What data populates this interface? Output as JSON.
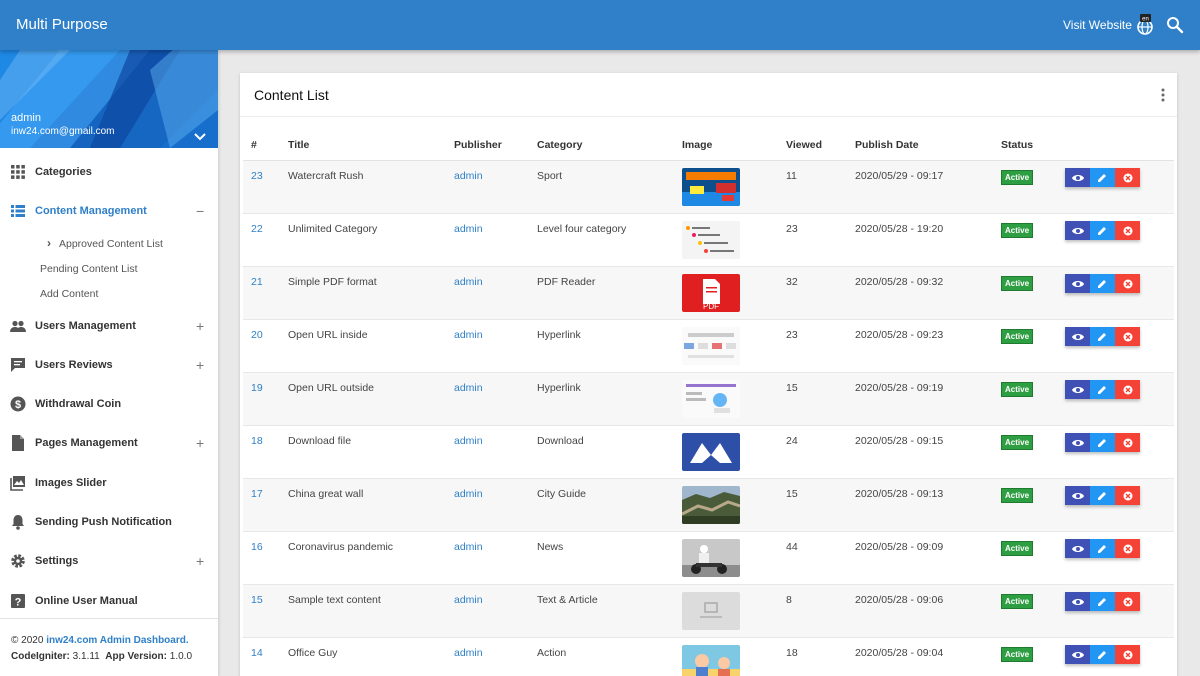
{
  "header": {
    "brand": "Multi Purpose",
    "visit_label": "Visit Website",
    "lang_code": "en"
  },
  "profile": {
    "name": "admin",
    "email": "inw24.com@gmail.com"
  },
  "sidebar": {
    "items": [
      {
        "label": "Categories",
        "icon": "grid-icon",
        "expand": ""
      },
      {
        "label": "Content Management",
        "icon": "list-icon",
        "expand": "−"
      },
      {
        "label": "Users Management",
        "icon": "users-icon",
        "expand": "+"
      },
      {
        "label": "Users Reviews",
        "icon": "comment-icon",
        "expand": "+"
      },
      {
        "label": "Withdrawal Coin",
        "icon": "dollar-icon",
        "expand": ""
      },
      {
        "label": "Pages Management",
        "icon": "file-icon",
        "expand": "+"
      },
      {
        "label": "Images Slider",
        "icon": "image-icon",
        "expand": ""
      },
      {
        "label": "Sending Push Notification",
        "icon": "bell-icon",
        "expand": ""
      },
      {
        "label": "Settings",
        "icon": "gear-icon",
        "expand": "+"
      },
      {
        "label": "Online User Manual",
        "icon": "help-icon",
        "expand": ""
      }
    ],
    "content_sub": [
      {
        "label": "Approved Content List",
        "prefix": "›"
      },
      {
        "label": "Pending Content List"
      },
      {
        "label": "Add Content"
      }
    ]
  },
  "footer": {
    "copyright": "© 2020",
    "site": "inw24.com Admin Dashboard.",
    "ci_label": "CodeIgniter:",
    "ci_version": "3.1.11",
    "app_label": "App Version:",
    "app_version": "1.0.0"
  },
  "card": {
    "title": "Content List"
  },
  "table": {
    "columns": [
      "#",
      "Title",
      "Publisher",
      "Category",
      "Image",
      "Viewed",
      "Publish Date",
      "Status"
    ],
    "rows": [
      {
        "id": "23",
        "title": "Watercraft Rush",
        "publisher": "admin",
        "category": "Sport",
        "viewed": "11",
        "date": "2020/05/29 - 09:17",
        "status": "Active",
        "thumb": "watercraft"
      },
      {
        "id": "22",
        "title": "Unlimited Category",
        "publisher": "admin",
        "category": "Level four category",
        "viewed": "23",
        "date": "2020/05/28 - 19:20",
        "status": "Active",
        "thumb": "category"
      },
      {
        "id": "21",
        "title": "Simple PDF format",
        "publisher": "admin",
        "category": "PDF Reader",
        "viewed": "32",
        "date": "2020/05/28 - 09:32",
        "status": "Active",
        "thumb": "pdf"
      },
      {
        "id": "20",
        "title": "Open URL inside",
        "publisher": "admin",
        "category": "Hyperlink",
        "viewed": "23",
        "date": "2020/05/28 - 09:23",
        "status": "Active",
        "thumb": "web"
      },
      {
        "id": "19",
        "title": "Open URL outside",
        "publisher": "admin",
        "category": "Hyperlink",
        "viewed": "15",
        "date": "2020/05/28 - 09:19",
        "status": "Active",
        "thumb": "web2"
      },
      {
        "id": "18",
        "title": "Download file",
        "publisher": "admin",
        "category": "Download",
        "viewed": "24",
        "date": "2020/05/28 - 09:15",
        "status": "Active",
        "thumb": "logo"
      },
      {
        "id": "17",
        "title": "China great wall",
        "publisher": "admin",
        "category": "City Guide",
        "viewed": "15",
        "date": "2020/05/28 - 09:13",
        "status": "Active",
        "thumb": "wall"
      },
      {
        "id": "16",
        "title": "Coronavirus pandemic",
        "publisher": "admin",
        "category": "News",
        "viewed": "44",
        "date": "2020/05/28 - 09:09",
        "status": "Active",
        "thumb": "corona"
      },
      {
        "id": "15",
        "title": "Sample text content",
        "publisher": "admin",
        "category": "Text & Article",
        "viewed": "8",
        "date": "2020/05/28 - 09:06",
        "status": "Active",
        "thumb": "placeholder"
      },
      {
        "id": "14",
        "title": "Office Guy",
        "publisher": "admin",
        "category": "Action",
        "viewed": "18",
        "date": "2020/05/28 - 09:04",
        "status": "Active",
        "thumb": "cartoon"
      }
    ]
  },
  "colors": {
    "primary": "#2f80c8",
    "active": "#2e9e43",
    "view": "#3f51b5",
    "edit": "#2196f3",
    "delete": "#f44336"
  }
}
